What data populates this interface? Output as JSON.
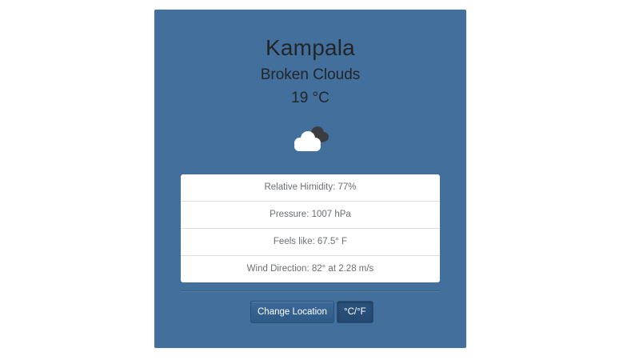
{
  "weather": {
    "city": "Kampala",
    "condition": "Broken Clouds",
    "temperature": "19 °C",
    "icon": "broken-clouds-icon"
  },
  "details": [
    {
      "text": "Relative Himidity: 77%"
    },
    {
      "text": "Pressure: 1007 hPa"
    },
    {
      "text": "Feels like: 67.5° F"
    },
    {
      "text": "Wind Direction: 82° at 2.28 m/s"
    }
  ],
  "actions": {
    "change_location_label": "Change Location",
    "unit_toggle_label": "°C/°F"
  },
  "colors": {
    "card_background": "#436f9d",
    "text_dark": "#222629",
    "button": "#2f5a87"
  }
}
